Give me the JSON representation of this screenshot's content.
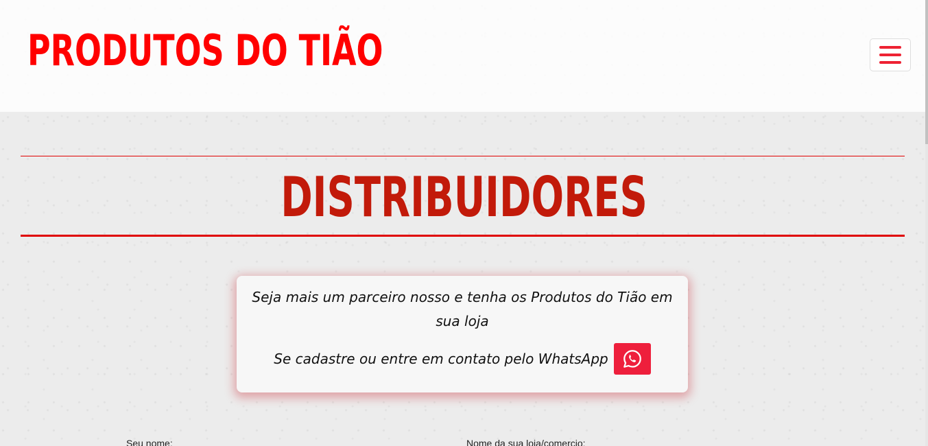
{
  "header": {
    "brand": "PRODUTOS DO TIÃO",
    "menu_icon": "hamburger-menu-icon"
  },
  "section": {
    "title": "DISTRIBUIDORES"
  },
  "info": {
    "text": "Seja mais um parceiro nosso e tenha os Produtos do Tião em sua loja",
    "whatsapp_text": "Se cadastre ou entre em contato pelo WhatsApp",
    "whatsapp_icon": "whatsapp-icon"
  },
  "form": {
    "name_label": "Seu nome:",
    "store_label": "Nome da sua loja/comercio:"
  },
  "colors": {
    "brand_red": "#ff0000",
    "title_red": "#c21a0a",
    "whatsapp_button": "#ee1f3c"
  }
}
